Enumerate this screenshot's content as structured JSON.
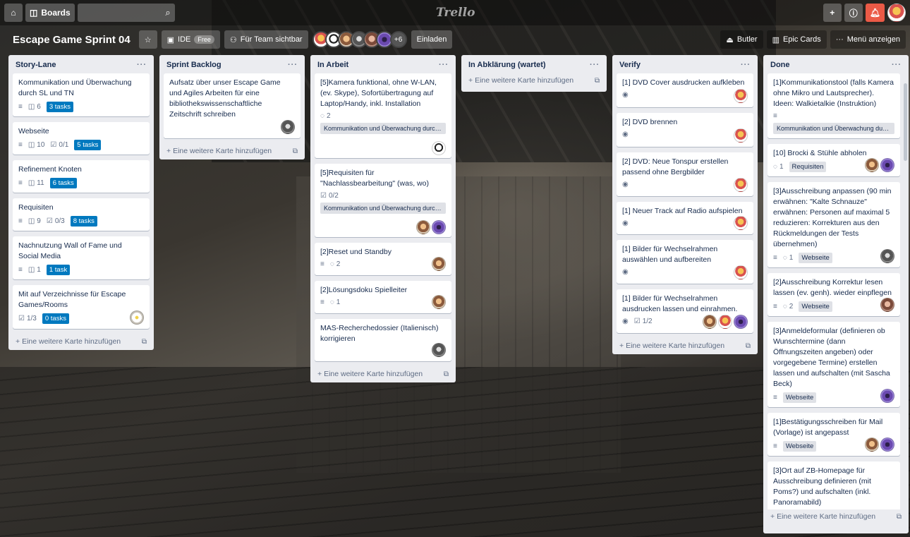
{
  "topbar": {
    "home_icon": "home-icon",
    "boards_label": "Boards",
    "search_placeholder": "",
    "logo": "Trello"
  },
  "board": {
    "title": "Escape Game Sprint 04",
    "workspace": "IDE",
    "workspace_badge": "Free",
    "visibility": "Für Team sichtbar",
    "member_extra": "+6",
    "invite": "Einladen",
    "butler": "Butler",
    "epic_cards": "Epic Cards",
    "menu": "Menü anzeigen"
  },
  "lists": [
    {
      "name": "Story-Lane",
      "add": "Eine weitere Karte hinzufügen",
      "cards": [
        {
          "title": "Kommunikation und Überwachung durch SL und TN",
          "links": "6",
          "tasks": "3 tasks"
        },
        {
          "title": "Webseite",
          "links": "10",
          "checklist": "0/1",
          "tasks": "5 tasks"
        },
        {
          "title": "Refinement Knoten",
          "links": "11",
          "tasks": "6 tasks"
        },
        {
          "title": "Requisiten",
          "links": "9",
          "checklist": "0/3",
          "tasks": "8 tasks"
        },
        {
          "title": "Nachnutzung Wall of Fame und Social Media",
          "links": "1",
          "tasks": "1 task"
        },
        {
          "title": "Mit auf Verzeichnisse für Escape Games/Rooms",
          "checklist": "1/3",
          "tasks": "0 tasks"
        }
      ]
    },
    {
      "name": "Sprint Backlog",
      "add": "Eine weitere Karte hinzufügen",
      "cards": [
        {
          "title": "Aufsatz über unser Escape Game und Agiles Arbeiten für eine bibliothekswissenschaftliche Zeitschrift schreiben"
        }
      ]
    },
    {
      "name": "In Arbeit",
      "add": "Eine weitere Karte hinzufügen",
      "cards": [
        {
          "title": "[5]Kamera funktional, ohne W-LAN, (ev. Skype), Sofortübertragung auf Laptop/Handy, inkl. Installation",
          "comments": "2",
          "label": "Kommunikation und Überwachung durch ..."
        },
        {
          "title": "[5]Requisiten für \"Nachlassbearbeitung\" (was, wo)",
          "checklist": "0/2",
          "label": "Kommunikation und Überwachung durch ..."
        },
        {
          "title": "[2]Reset und Standby",
          "comments": "2"
        },
        {
          "title": "[2]Lösungsdoku Spielleiter",
          "comments": "1"
        },
        {
          "title": "MAS-Recherchedossier (Italienisch) korrigieren"
        }
      ]
    },
    {
      "name": "In Abklärung (wartet)",
      "add": "Eine weitere Karte hinzufügen",
      "cards": []
    },
    {
      "name": "Verify",
      "add": "Eine weitere Karte hinzufügen",
      "cards": [
        {
          "title": "[1] DVD Cover ausdrucken aufkleben"
        },
        {
          "title": "[2] DVD brennen"
        },
        {
          "title": "[2] DVD: Neue Tonspur erstellen passend ohne Bergbilder"
        },
        {
          "title": "[1] Neuer Track auf Radio aufspielen"
        },
        {
          "title": "[1] Bilder für Wechselrahmen auswählen und aufbereiten"
        },
        {
          "title": "[1] Bilder für Wechselrahmen ausdrucken lassen und einrahmen.",
          "checklist": "1/2"
        }
      ]
    },
    {
      "name": "Done",
      "add": "Eine weitere Karte hinzufügen",
      "cards": [
        {
          "title": "[1]Kommunikationstool (falls Kamera ohne Mikro und Lautsprecher). Ideen: Walkietalkie (Instruktion)",
          "label": "Kommunikation und Überwachung durch..."
        },
        {
          "title": "[10] Brocki & Stühle abholen",
          "comments": "1",
          "label": "Requisiten"
        },
        {
          "title": "[3]Ausschreibung anpassen (90 min erwähnen: \"Kalte Schnauze\" erwähnen: Personen auf maximal 5 reduzieren: Korrekturen aus den Rückmeldungen der Tests übernehmen)",
          "comments": "1",
          "label": "Webseite"
        },
        {
          "title": "[2]Ausschreibung Korrektur lesen lassen (ev. genh). wieder einpflegen",
          "comments": "2",
          "label": "Webseite"
        },
        {
          "title": "[3]Anmeldeformular (definieren ob Wunschtermine (dann Öffnungszeiten angeben) oder vorgegebene Termine) erstellen lassen und aufschalten (mit Sascha Beck)",
          "label": "Webseite"
        },
        {
          "title": "[1]Bestätigungsschreiben für Mail (Vorlage) ist angepasst",
          "label": "Webseite"
        },
        {
          "title": "[3]Ort auf ZB-Homepage für Ausschreibung definieren (mit Poms?) und aufschalten (inkl. Panoramabild)"
        }
      ]
    }
  ]
}
